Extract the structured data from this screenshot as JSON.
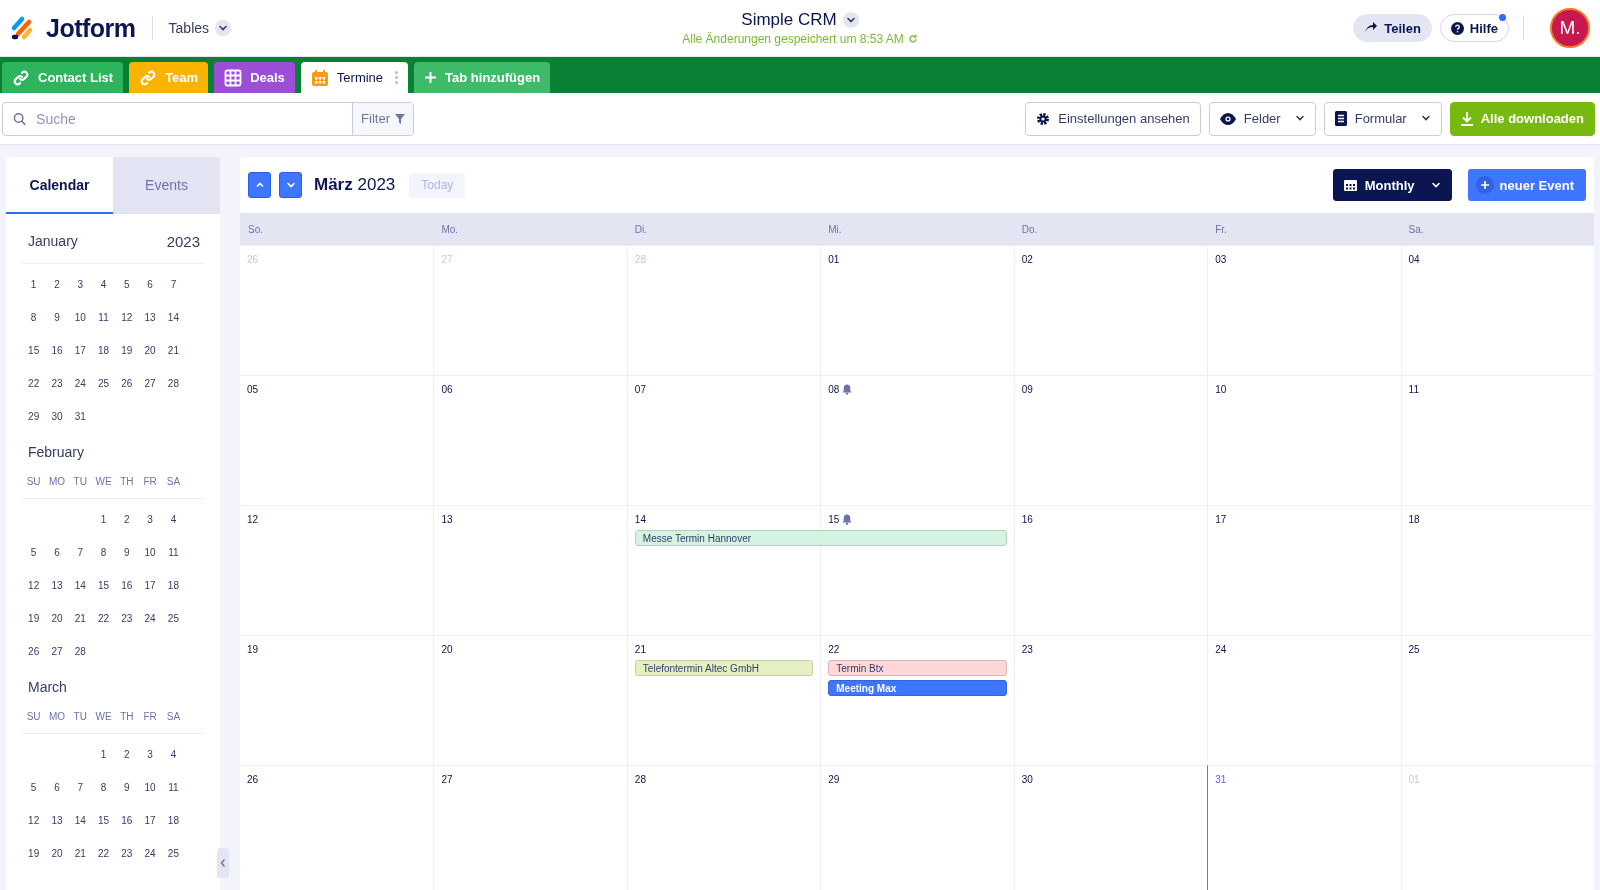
{
  "header": {
    "brand": "Jotform",
    "product": "Tables",
    "title": "Simple CRM",
    "save_status": "Alle Änderungen gespeichert um 8:53 AM",
    "share": "Teilen",
    "help": "Hilfe",
    "help_notification": true,
    "avatar": "M."
  },
  "tabs": [
    {
      "label": "Contact List",
      "kind": "link",
      "color": "#2db55d",
      "selected": false
    },
    {
      "label": "Team",
      "kind": "link",
      "color": "#f9b300",
      "selected": false
    },
    {
      "label": "Deals",
      "kind": "grid",
      "color": "#9c4fd6",
      "selected": false
    },
    {
      "label": "Termine",
      "kind": "calendar",
      "color": "#f79a1e",
      "selected": true
    }
  ],
  "add_tab": "Tab hinzufügen",
  "toolbar": {
    "search_placeholder": "Suche",
    "filter": "Filter",
    "settings": "Einstellungen ansehen",
    "fields": "Felder",
    "form": "Formular",
    "download": "Alle downloaden"
  },
  "sidebar_tabs": [
    {
      "label": "Calendar",
      "selected": true
    },
    {
      "label": "Events",
      "selected": false
    }
  ],
  "mini_calendar": {
    "year": "2023",
    "months": [
      {
        "name": "January",
        "weeks": [
          [
            "1",
            "2",
            "3",
            "4",
            "5",
            "6",
            "7"
          ],
          [
            "8",
            "9",
            "10",
            "11",
            "12",
            "13",
            "14"
          ],
          [
            "15",
            "16",
            "17",
            "18",
            "19",
            "20",
            "21"
          ],
          [
            "22",
            "23",
            "24",
            "25",
            "26",
            "27",
            "28"
          ],
          [
            "29",
            "30",
            "31"
          ]
        ]
      },
      {
        "name": "February",
        "weekdays": [
          "SU",
          "MO",
          "TU",
          "WE",
          "TH",
          "FR",
          "SA"
        ],
        "weeks": [
          [
            "1",
            "2",
            "3",
            "4"
          ],
          [
            "5",
            "6",
            "7",
            "8",
            "9",
            "10",
            "11"
          ],
          [
            "12",
            "13",
            "14",
            "15",
            "16",
            "17",
            "18"
          ],
          [
            "19",
            "20",
            "21",
            "22",
            "23",
            "24",
            "25"
          ],
          [
            "26",
            "27",
            "28"
          ]
        ]
      },
      {
        "name": "March",
        "weekdays": [
          "SU",
          "MO",
          "TU",
          "WE",
          "TH",
          "FR",
          "SA"
        ],
        "weeks": [
          [
            "1",
            "2",
            "3",
            "4"
          ],
          [
            "5",
            "6",
            "7",
            "8",
            "9",
            "10",
            "11"
          ],
          [
            "12",
            "13",
            "14",
            "15",
            "16",
            "17",
            "18"
          ],
          [
            "19",
            "20",
            "21",
            "22",
            "23",
            "24",
            "25"
          ]
        ]
      }
    ]
  },
  "calendar": {
    "month": "März",
    "year": "2023",
    "today_button": "Today",
    "view": "Monthly",
    "new_event": "neuer Event",
    "weekdays": [
      "So.",
      "Mo.",
      "Di.",
      "Mi.",
      "Do.",
      "Fr.",
      "Sa."
    ],
    "weeks": [
      {
        "days": [
          {
            "day": "26",
            "outside": true,
            "today": false,
            "reminder": false
          },
          {
            "day": "27",
            "outside": true,
            "today": false,
            "reminder": false
          },
          {
            "day": "28",
            "outside": true,
            "today": false,
            "reminder": false
          },
          {
            "day": "01",
            "outside": false,
            "today": false,
            "reminder": false
          },
          {
            "day": "02",
            "outside": false,
            "today": false,
            "reminder": false
          },
          {
            "day": "03",
            "outside": false,
            "today": false,
            "reminder": false
          },
          {
            "day": "04",
            "outside": false,
            "today": false,
            "reminder": false
          }
        ]
      },
      {
        "days": [
          {
            "day": "05",
            "outside": false,
            "today": false,
            "reminder": false
          },
          {
            "day": "06",
            "outside": false,
            "today": false,
            "reminder": false
          },
          {
            "day": "07",
            "outside": false,
            "today": false,
            "reminder": false
          },
          {
            "day": "08",
            "outside": false,
            "today": false,
            "reminder": true
          },
          {
            "day": "09",
            "outside": false,
            "today": false,
            "reminder": false
          },
          {
            "day": "10",
            "outside": false,
            "today": false,
            "reminder": false
          },
          {
            "day": "11",
            "outside": false,
            "today": false,
            "reminder": false
          }
        ]
      },
      {
        "days": [
          {
            "day": "12",
            "outside": false,
            "today": false,
            "reminder": false
          },
          {
            "day": "13",
            "outside": false,
            "today": false,
            "reminder": false
          },
          {
            "day": "14",
            "outside": false,
            "today": false,
            "reminder": false,
            "events": [
              {
                "title": "Messe Termin Hannover",
                "kind": "two-day",
                "color": "#d5f3e1"
              }
            ]
          },
          {
            "day": "15",
            "outside": false,
            "today": false,
            "reminder": true
          },
          {
            "day": "16",
            "outside": false,
            "today": false,
            "reminder": false
          },
          {
            "day": "17",
            "outside": false,
            "today": false,
            "reminder": false
          },
          {
            "day": "18",
            "outside": false,
            "today": false,
            "reminder": false
          }
        ]
      },
      {
        "days": [
          {
            "day": "19",
            "outside": false,
            "today": false,
            "reminder": false
          },
          {
            "day": "20",
            "outside": false,
            "today": false,
            "reminder": false
          },
          {
            "day": "21",
            "outside": false,
            "today": false,
            "reminder": false,
            "events": [
              {
                "title": "Telefontermin Altec GmbH",
                "kind": "single",
                "color": "#e6f1c2"
              }
            ]
          },
          {
            "day": "22",
            "outside": false,
            "today": false,
            "reminder": false,
            "events": [
              {
                "title": "Termin Btx",
                "kind": "single",
                "color": "#fdd7d7"
              },
              {
                "title": "Meeting Max",
                "kind": "single",
                "color": "#3f76ff"
              }
            ]
          },
          {
            "day": "23",
            "outside": false,
            "today": false,
            "reminder": false
          },
          {
            "day": "24",
            "outside": false,
            "today": false,
            "reminder": false
          },
          {
            "day": "25",
            "outside": false,
            "today": false,
            "reminder": false
          }
        ]
      },
      {
        "days": [
          {
            "day": "26",
            "outside": false,
            "today": false,
            "reminder": false
          },
          {
            "day": "27",
            "outside": false,
            "today": false,
            "reminder": false
          },
          {
            "day": "28",
            "outside": false,
            "today": false,
            "reminder": false
          },
          {
            "day": "29",
            "outside": false,
            "today": false,
            "reminder": false
          },
          {
            "day": "30",
            "outside": false,
            "today": false,
            "reminder": false
          },
          {
            "day": "31",
            "outside": false,
            "today": true,
            "reminder": false
          },
          {
            "day": "01",
            "outside": true,
            "today": false,
            "reminder": false
          }
        ]
      }
    ]
  }
}
